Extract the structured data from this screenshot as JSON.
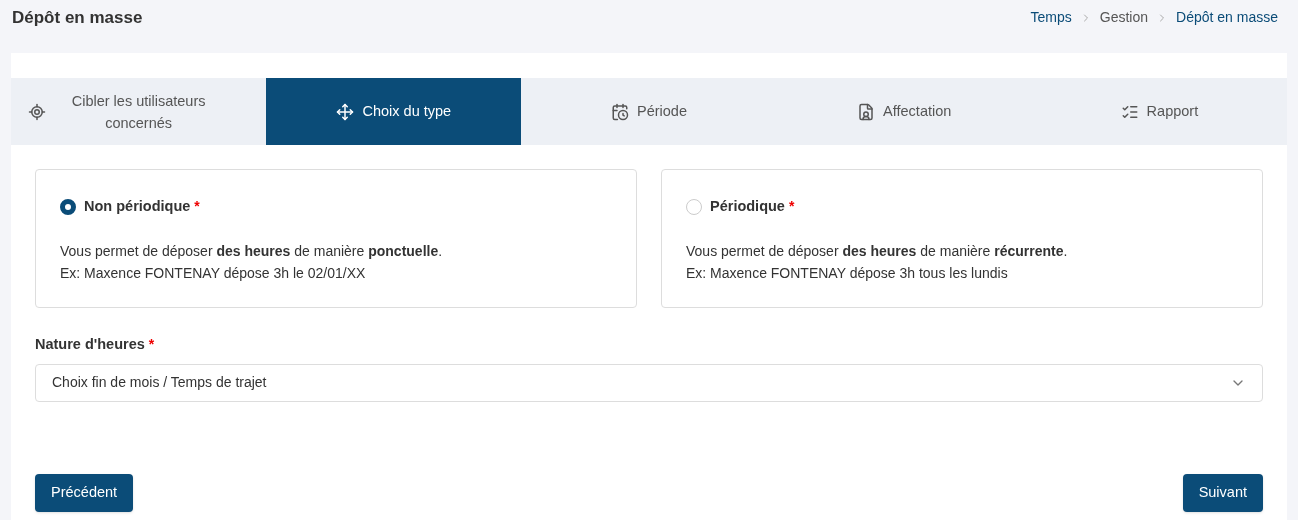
{
  "page_title": "Dépôt en masse",
  "breadcrumb": [
    {
      "label": "Temps",
      "current": false
    },
    {
      "label": "Gestion",
      "current": true
    },
    {
      "label": "Dépôt en masse",
      "current": false
    }
  ],
  "steps": [
    {
      "label": "Cibler les utilisateurs concernés",
      "selected": false
    },
    {
      "label": "Choix du type",
      "selected": true
    },
    {
      "label": "Période",
      "selected": false
    },
    {
      "label": "Affectation",
      "selected": false
    },
    {
      "label": "Rapport",
      "selected": false
    }
  ],
  "options": [
    {
      "label": "Non périodique",
      "required_mark": "*",
      "selected": true,
      "description": "Vous permet de déposer **des heures** de manière **ponctuelle**.",
      "example": "Ex: Maxence FONTENAY dépose 3h le 02/01/XX"
    },
    {
      "label": "Périodique",
      "required_mark": "*",
      "selected": false,
      "description": "Vous permet de déposer **des heures** de manière **récurrente**.",
      "example": "Ex: Maxence FONTENAY dépose 3h tous les lundis"
    }
  ],
  "hours_field": {
    "label": "Nature d'heures",
    "required_mark": "*",
    "value": "Choix fin de mois / Temps de trajet"
  },
  "buttons": {
    "previous": "Précédent",
    "next": "Suivant"
  }
}
